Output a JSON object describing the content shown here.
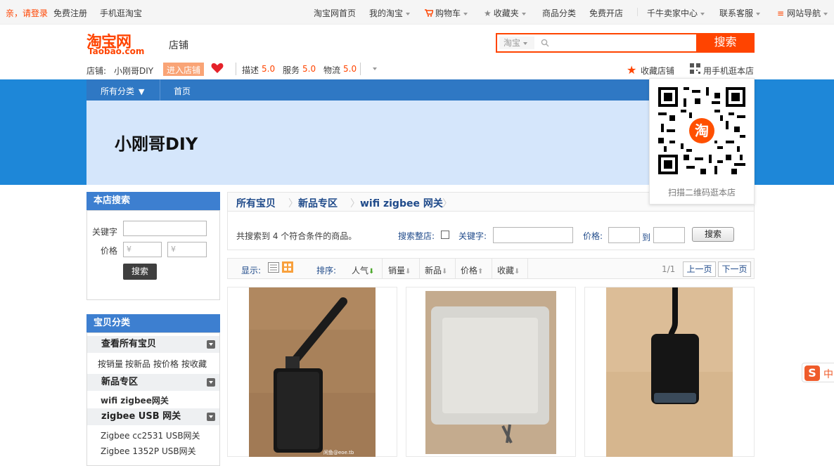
{
  "topbar": {
    "login": "亲，请登录",
    "register": "免费注册",
    "mobile": "手机逛淘宝",
    "home": "淘宝网首页",
    "my_taobao": "我的淘宝",
    "cart": "购物车",
    "favorites": "收藏夹",
    "categories": "商品分类",
    "open_shop": "免费开店",
    "seller_center": "千牛卖家中心",
    "service": "联系客服",
    "site_nav": "网站导航"
  },
  "header": {
    "logo_cn": "淘宝网",
    "logo_en": "Taobao.com",
    "section": "店铺",
    "search_scope": "淘宝",
    "search_button": "搜索"
  },
  "shopinfo": {
    "shop_label": "店铺:",
    "shop_name": "小刚哥DIY",
    "enter_shop": "进入店铺",
    "desc_label": "描述",
    "desc_score": "5.0",
    "service_label": "服务",
    "service_score": "5.0",
    "logistics_label": "物流",
    "logistics_score": "5.0",
    "collect_shop": "收藏店铺",
    "mobile_visit": "用手机逛本店"
  },
  "shopnav": {
    "all_categories": "所有分类",
    "home": "首页",
    "banner_title": "小刚哥DIY"
  },
  "qr": {
    "caption": "扫描二维码逛本店",
    "badge": "淘"
  },
  "sidebar": {
    "search_title": "本店搜索",
    "keyword_label": "关键字",
    "price_label": "价格",
    "price_placeholder": "¥",
    "search_button": "搜索",
    "category_title": "宝贝分类",
    "view_all": "查看所有宝贝",
    "sort_links": [
      "按销量",
      "按新品",
      "按价格",
      "按收藏"
    ],
    "new_section": "新品专区",
    "new_item": "wifi zigbee网关",
    "usb_section": "zigbee USB 网关",
    "usb_items": [
      "Zigbee cc2531 USB网关",
      "Zigbee 1352P USB网关"
    ]
  },
  "main": {
    "crumbs": [
      "所有宝贝",
      "新品专区",
      "wifi zigbee 网关"
    ],
    "result_text": "共搜索到 4 个符合条件的商品。",
    "search_all": "搜索整店:",
    "keyword_label": "关键字:",
    "price_label": "价格:",
    "to": "到",
    "search_button": "搜索",
    "display_label": "显示:",
    "sort_label": "排序:",
    "sort_options": [
      "人气",
      "销量",
      "新品",
      "价格",
      "收藏"
    ],
    "page": "1/1",
    "prev": "上一页",
    "next": "下一页",
    "watermark": "闲鱼@eoe.tb"
  },
  "colors": {
    "accent": "#ff4400",
    "nav_blue": "#1e87d8",
    "banner": "#d5e6fb",
    "link_blue": "#1f4a8a"
  }
}
